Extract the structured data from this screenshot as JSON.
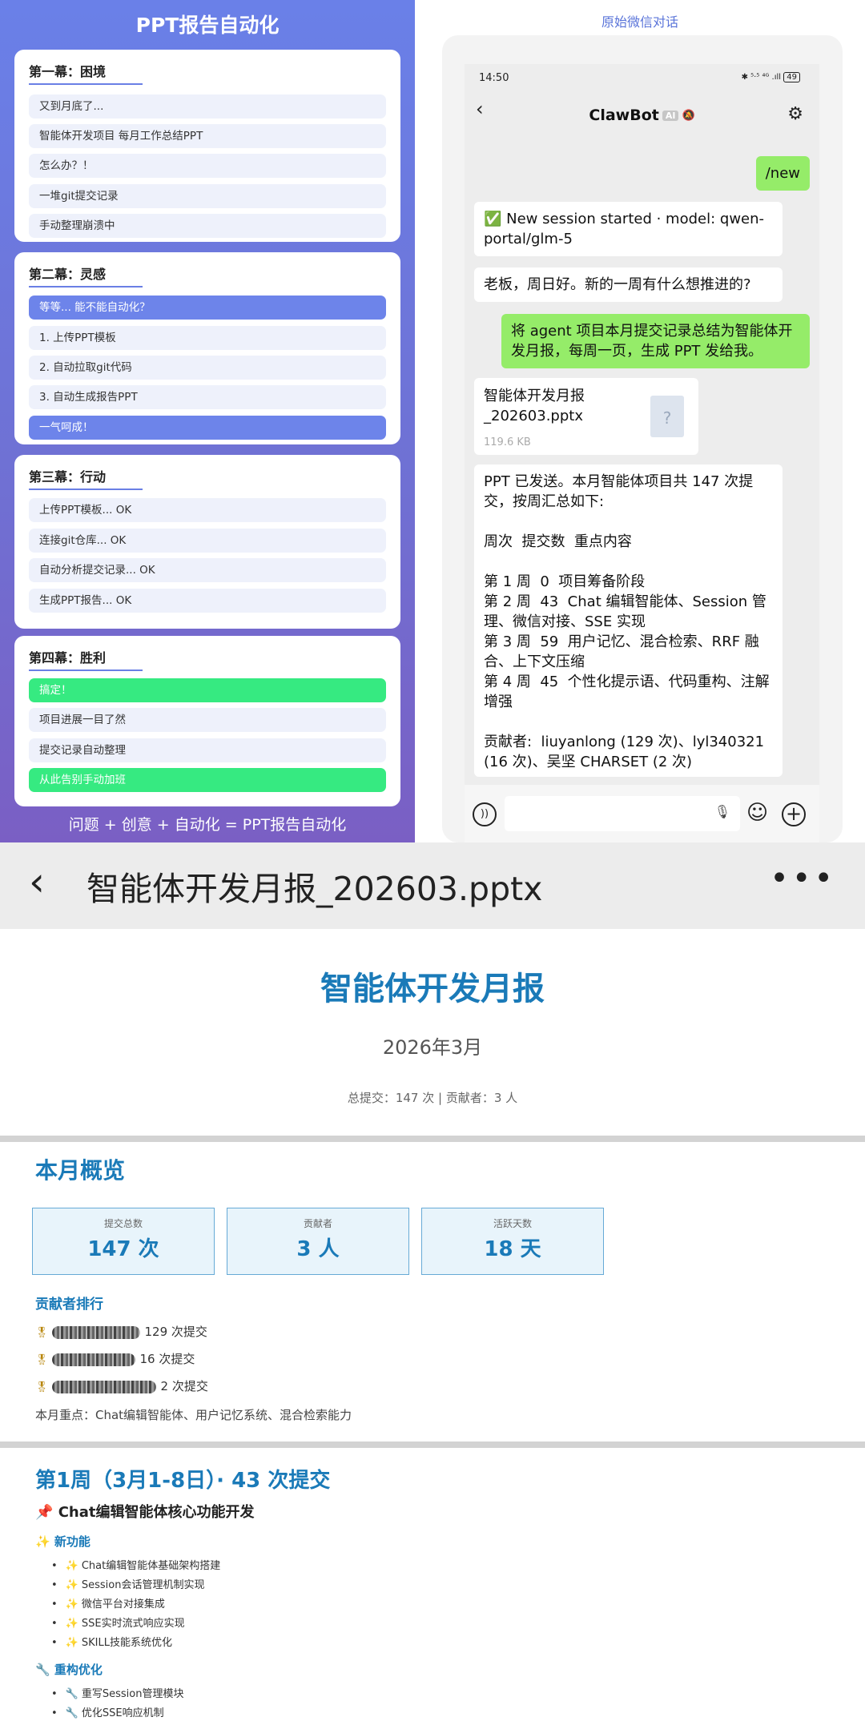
{
  "left": {
    "title": "PPT报告自动化",
    "acts": [
      {
        "title": "第一幕：困境",
        "items": [
          {
            "text": "又到月底了...",
            "style": "plain"
          },
          {
            "text": "智能体开发项目 每月工作总结PPT",
            "style": "plain"
          },
          {
            "text": "怎么办？！",
            "style": "plain"
          },
          {
            "text": "一堆git提交记录",
            "style": "plain"
          },
          {
            "text": "手动整理崩溃中",
            "style": "plain"
          }
        ]
      },
      {
        "title": "第二幕：灵感",
        "items": [
          {
            "text": "等等... 能不能自动化？",
            "style": "blue"
          },
          {
            "text": "1. 上传PPT模板",
            "style": "plain"
          },
          {
            "text": "2. 自动拉取git代码",
            "style": "plain"
          },
          {
            "text": "3. 自动生成报告PPT",
            "style": "plain"
          },
          {
            "text": "一气呵成！",
            "style": "blue"
          }
        ]
      },
      {
        "title": "第三幕：行动",
        "items": [
          {
            "text": "上传PPT模板... OK",
            "style": "plain"
          },
          {
            "text": "连接git仓库... OK",
            "style": "plain"
          },
          {
            "text": "自动分析提交记录... OK",
            "style": "plain"
          },
          {
            "text": "生成PPT报告... OK",
            "style": "plain"
          }
        ]
      },
      {
        "title": "第四幕：胜利",
        "items": [
          {
            "text": "搞定！",
            "style": "green"
          },
          {
            "text": "项目进展一目了然",
            "style": "plain"
          },
          {
            "text": "提交记录自动整理",
            "style": "plain"
          },
          {
            "text": "从此告别手动加班",
            "style": "green"
          }
        ]
      }
    ],
    "footer": "问题 + 创意 + 自动化 = PPT报告自动化"
  },
  "right": {
    "title": "原始微信对话",
    "status_time": "14:50",
    "status_right": "✱ ⁵·⁵ ⁴ᴳ .ıll",
    "battery": "49",
    "chat_title": "ClawBot",
    "ai_badge": "AI",
    "messages": {
      "m1": "/new",
      "m2": "✅ New session started · model: qwen-portal/glm-5",
      "m3": "老板，周日好。新的一周有什么想推进的?",
      "m4": "将 agent 项目本月提交记录总结为智能体开发月报，每周一页，生成 PPT 发给我。",
      "file_name": "智能体开发月报_202603.pptx",
      "file_size": "119.6 KB",
      "m6": [
        "PPT 已发送。本月智能体项目共 147 次提交，按周汇总如下:",
        "",
        "周次  提交数  重点内容",
        "",
        "第 1 周  0  项目筹备阶段",
        "第 2 周  43  Chat 编辑智能体、Session 管理、微信对接、SSE 实现",
        "第 3 周  59  用户记忆、混合检索、RRF 融合、上下文压缩",
        "第 4 周  45  个性化提示语、代码重构、注解增强",
        "",
        "贡献者:  liuyanlong (129 次)、lyl340321 (16 次)、吴坚 CHARSET (2 次)"
      ]
    }
  },
  "viewer": {
    "file_title": "智能体开发月报_202603.pptx",
    "slide1": {
      "title": "智能体开发月报",
      "date": "2026年3月",
      "subtitle": "总提交：147 次 | 贡献者：3 人"
    },
    "slide2": {
      "heading": "本月概览",
      "stats": [
        {
          "label": "提交总数",
          "value": "147 次"
        },
        {
          "label": "贡献者",
          "value": "3 人"
        },
        {
          "label": "活跃天数",
          "value": "18 天"
        }
      ],
      "rank_heading": "贡献者排行",
      "contributors": [
        {
          "count": "129 次提交"
        },
        {
          "count": "16 次提交"
        },
        {
          "count": "2 次提交"
        }
      ],
      "focus": "本月重点：Chat编辑智能体、用户记忆系统、混合检索能力"
    },
    "slide3": {
      "title": "第1周（3月1-8日）· 43 次提交",
      "subtitle": "Chat编辑智能体核心功能开发",
      "new_heading": "新功能",
      "new_items": [
        "Chat编辑智能体基础架构搭建",
        "Session会话管理机制实现",
        "微信平台对接集成",
        "SSE实时流式响应实现",
        "SKILL技能系统优化"
      ],
      "refactor_heading": "重构优化",
      "refactor_items": [
        "重写Session管理模块",
        "优化SSE响应机制"
      ]
    }
  }
}
